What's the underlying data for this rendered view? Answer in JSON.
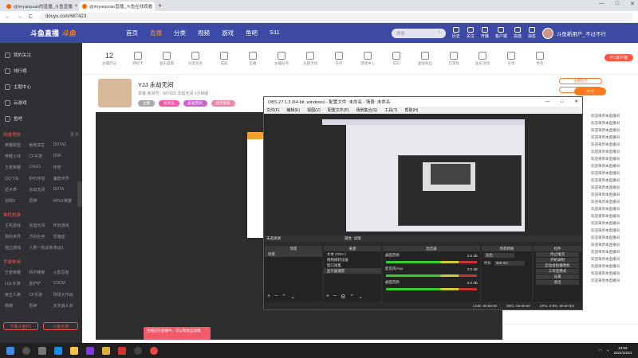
{
  "browser": {
    "tabs": [
      {
        "title": "@imyanpzan的直播_斗鱼直播",
        "active": false
      },
      {
        "title": "@imyanpzan直播_斗鱼在线观看",
        "active": true
      }
    ],
    "new_tab": "+",
    "url": "douyu.com/687423",
    "nav": {
      "back": "←",
      "forward": "→",
      "reload": "C"
    },
    "window_controls": [
      "—",
      "□",
      "✕"
    ]
  },
  "site": {
    "logo": "斗鱼直播",
    "logo_badge": "斗鱼",
    "nav_links": [
      "首页",
      "直播",
      "分类",
      "视频",
      "游戏",
      "鱼吧",
      "S11"
    ],
    "active_nav": "直播",
    "search_placeholder": "搜索",
    "search_icon": "search-icon",
    "top_icons": [
      "历史",
      "关注",
      "开播",
      "客户端",
      "充值",
      "消息"
    ],
    "user_name": "斗鱼新用户_不过不行"
  },
  "sidebar": {
    "items": [
      "我的关注",
      "排行榜",
      "主题中心",
      "云游戏",
      "鱼吧"
    ],
    "section_title": "网游竞技",
    "section_more": "更多",
    "grid": [
      "英雄联盟",
      "绝地求生",
      "DOTA2",
      "穿越火线",
      "CF手游",
      "DNF",
      "王者荣耀",
      "CSGO",
      "传奇",
      "QQ飞车",
      "炉石传说",
      "魔兽世界",
      "逆水寒",
      "永劫无间",
      "DOTA",
      "剑网3",
      "原神",
      "APEX英雄"
    ],
    "section2_title": "单机热游",
    "grid2": [
      "主机游戏",
      "永劫无间",
      "怀旧游戏",
      "我的世界",
      "方舟生存",
      "恐鬼症",
      "独立游戏",
      "人类一败涂地",
      "命运2"
    ],
    "section3_title": "手游休闲",
    "grid3": [
      "王者荣耀",
      "和平精英",
      "火影忍者",
      "LOL手游",
      "金铲铲",
      "CODM",
      "第五人格",
      "CF手游",
      "球球大作战",
      "棋牌",
      "原神",
      "天天狼人杀"
    ],
    "btn_left": "下载斗鱼PC",
    "btn_right": "斗鱼手游"
  },
  "categories": [
    {
      "label": "主播印记",
      "num": "12"
    },
    {
      "label": "特权卡",
      "badge": "新"
    },
    {
      "label": "鱼乐盛典"
    },
    {
      "label": "分区任务"
    },
    {
      "label": "成就"
    },
    {
      "label": "宝箱"
    },
    {
      "label": "主播任务"
    },
    {
      "label": "主题活动"
    },
    {
      "label": "任务"
    },
    {
      "label": "游戏中心"
    },
    {
      "label": "车队"
    },
    {
      "label": "超级粉丝"
    },
    {
      "label": "云游戏"
    },
    {
      "label": "鱼乐活动"
    },
    {
      "label": "分享"
    },
    {
      "label": "更多"
    }
  ],
  "pc_badge": "PC客户端",
  "room": {
    "title": "YJJ 永劫无间",
    "meta": "举报  房间号：687423  永劫无间  1分钟前",
    "tags": [
      "主播",
      "技术流",
      "永劫无间",
      "高手玩家"
    ],
    "follow": "关注",
    "top_btn1": "主播任务",
    "top_btn2": "粉丝团"
  },
  "chat": {
    "tip": "主播正在直播中，可以和他互动哦",
    "lines": [
      "欢迎来到本直播间",
      "欢迎来到本直播间",
      "欢迎来到本直播间",
      "欢迎来到本直播间",
      "欢迎来到本直播间",
      "欢迎来到本直播间",
      "欢迎来到本直播间",
      "欢迎来到本直播间",
      "欢迎来到本直播间",
      "欢迎来到本直播间",
      "欢迎来到本直播间",
      "欢迎来到本直播间",
      "欢迎来到本直播间",
      "欢迎来到本直播间",
      "欢迎来到本直播间",
      "欢迎来到本直播间",
      "欢迎来到本直播间",
      "欢迎来到本直播间",
      "欢迎来到本直播间",
      "欢迎来到本直播间",
      "欢迎来到本直播间",
      "欢迎来到本直播间",
      "欢迎来到本直播间",
      "欢迎来到本直播间"
    ]
  },
  "obs": {
    "title": "OBS 27.1.3 (64-bit, windows) - 配置文件: 未命名 - 场景: 未命名",
    "menu": [
      "文件(F)",
      "编辑(E)",
      "视图(V)",
      "配置文件(P)",
      "场景集合(S)",
      "工具(T)",
      "帮助(H)"
    ],
    "status_msg": "未选择源",
    "props_btn": "属性",
    "filters_btn": "滤镜",
    "docks": {
      "scenes": "场景",
      "sources": "来源",
      "mixer": "混音器",
      "transitions": "场景转换",
      "controls": "控件"
    },
    "scene_list": [
      "场景"
    ],
    "source_list": [
      "文本 (GDI+)",
      "视频捕获设备",
      "窗口采集",
      "显示器捕获"
    ],
    "mixer_tracks": [
      {
        "name": "桌面音频",
        "db": "0.0 dB"
      },
      {
        "name": "麦克风/Aux",
        "db": "0.0 dB"
      },
      {
        "name": "桌面音频",
        "db": "0.0 dB"
      }
    ],
    "transition_type": "淡出",
    "duration_label": "时长",
    "duration": "300 ms",
    "controls": [
      "停止推流",
      "开始录制",
      "启动虚拟摄像机",
      "工作室模式",
      "设置",
      "退出"
    ],
    "footer": {
      "live": "LIVE: 00:00:00",
      "rec": "REC: 00:00:00",
      "cpu": "CPU: 0.9%, 60.00 fps"
    }
  },
  "taskbar": {
    "time": "10:53",
    "date": "2021/10/23"
  }
}
